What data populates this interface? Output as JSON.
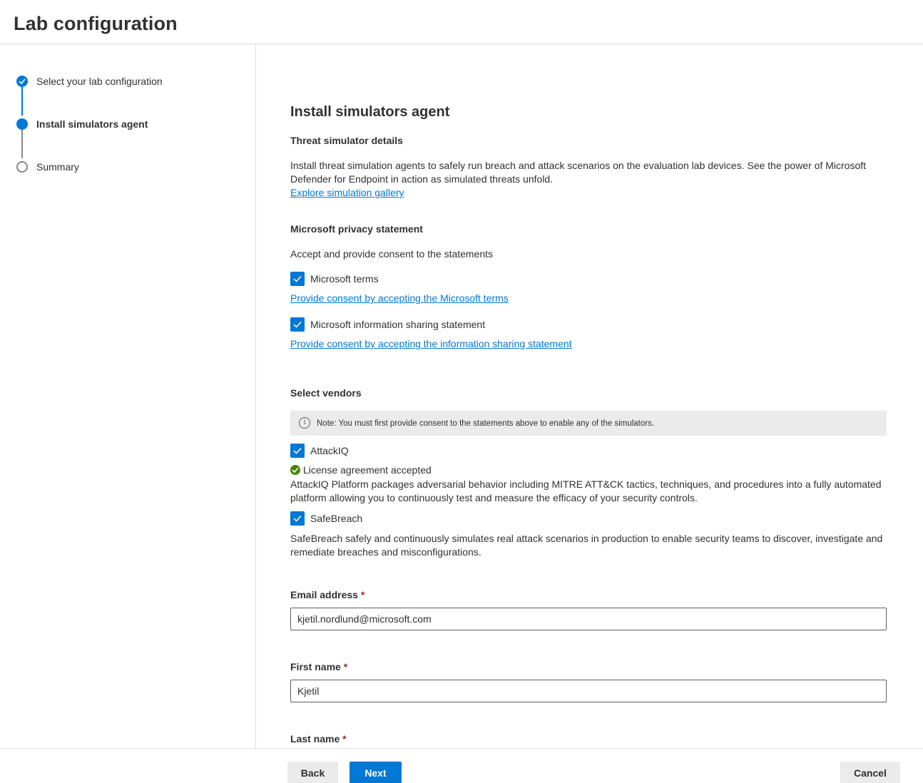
{
  "header": {
    "title": "Lab configuration"
  },
  "steps": [
    {
      "label": "Select your lab configuration",
      "state": "completed"
    },
    {
      "label": "Install simulators agent",
      "state": "current"
    },
    {
      "label": "Summary",
      "state": "pending"
    }
  ],
  "main": {
    "title": "Install simulators agent",
    "threat": {
      "heading": "Threat simulator details",
      "line1": "Install threat simulation agents to safely run breach and attack scenarios on the evaluation lab devices. See the power of Microsoft",
      "line2": "Defender for Endpoint in action as simulated threats unfold.",
      "link": "Explore simulation gallery"
    },
    "privacy": {
      "heading": "Microsoft privacy statement",
      "intro": "Accept and provide consent to the statements",
      "terms_label": "Microsoft terms",
      "terms_checked": true,
      "terms_link": "Provide consent by accepting the Microsoft terms",
      "sharing_label": "Microsoft information sharing statement",
      "sharing_checked": true,
      "sharing_link": "Provide consent by accepting the information sharing statement"
    },
    "vendors": {
      "heading": "Select vendors",
      "note": "Note: You must first provide consent to the statements above to enable any of the simulators.",
      "attackiq_label": "AttackIQ",
      "attackiq_checked": true,
      "license_status": "License agreement accepted",
      "attackiq_desc1": "AttackIQ Platform packages adversarial behavior including MITRE ATT&CK tactics, techniques, and procedures into a fully automated",
      "attackiq_desc2": "platform allowing you to continuously test and measure the efficacy of your security controls.",
      "safebreach_label": "SafeBreach",
      "safebreach_checked": true,
      "safebreach_desc1": "SafeBreach safely and continuously simulates real attack scenarios in production to enable security teams to discover, investigate and",
      "safebreach_desc2": "remediate breaches and misconfigurations."
    },
    "form": {
      "required_mark": "*",
      "email_label": "Email address",
      "email_value": "kjetil.nordlund@microsoft.com",
      "first_name_label": "First name",
      "first_name_value": "Kjetil",
      "last_name_label": "Last name"
    }
  },
  "footer": {
    "back": "Back",
    "next": "Next",
    "cancel": "Cancel"
  },
  "colors": {
    "accent": "#0078d4",
    "success": "#498205",
    "required": "#a4262c"
  }
}
